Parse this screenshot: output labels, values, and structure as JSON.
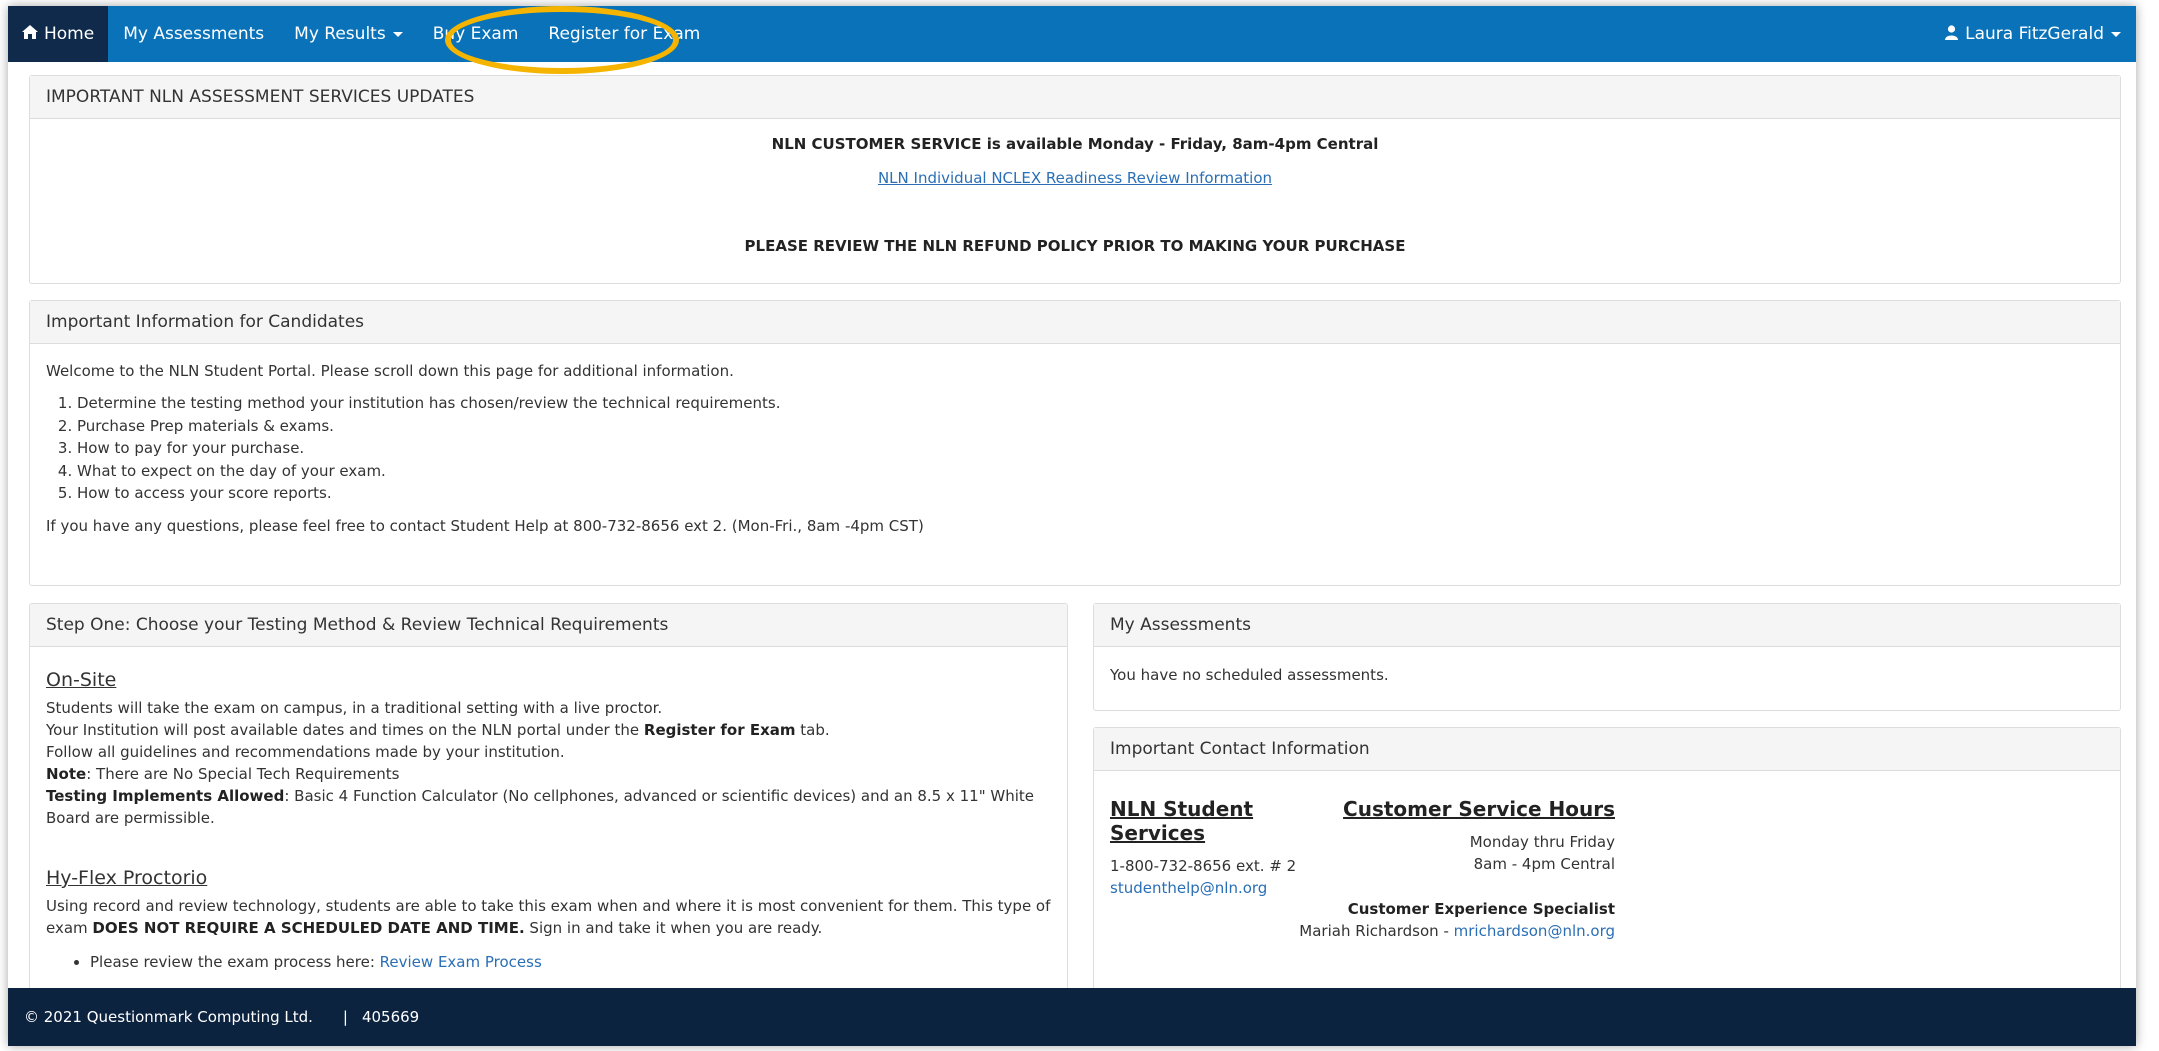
{
  "nav": {
    "home": "Home",
    "assessments": "My Assessments",
    "results": "My Results",
    "buy": "Buy Exam",
    "register": "Register for Exam",
    "user": "Laura FitzGerald"
  },
  "updates": {
    "heading": "IMPORTANT NLN ASSESSMENT SERVICES UPDATES",
    "customer_service": "NLN CUSTOMER SERVICE is available Monday - Friday, 8am-4pm Central",
    "nclex_link": "NLN Individual NCLEX Readiness Review Information",
    "refund": "PLEASE REVIEW THE NLN REFUND POLICY PRIOR TO MAKING YOUR PURCHASE"
  },
  "candidates": {
    "heading": "Important Information for Candidates",
    "welcome": "Welcome to the NLN Student Portal. Please scroll down this page for additional information.",
    "steps": [
      "Determine the testing method your institution has chosen/review the technical requirements.",
      "Purchase Prep materials & exams.",
      "How to pay for your purchase.",
      "What to expect on the day of your exam.",
      "How to access your score reports."
    ],
    "questions": "If you have any questions, please feel free to contact Student Help at 800-732-8656 ext 2. (Mon-Fri., 8am -4pm CST)"
  },
  "step_one": {
    "heading": "Step One: Choose your Testing Method & Review Technical Requirements",
    "onsite": {
      "title": "On-Site",
      "l1": "Students will take the exam on campus, in a traditional setting with a live proctor.",
      "l2_pre": "Your Institution will post available dates and times on the NLN portal under the ",
      "l2_bold": "Register for Exam",
      "l2_post": " tab.",
      "l3": "Follow all guidelines and recommendations made by your institution.",
      "note_label": "Note",
      "note_text": ": There are No Special Tech Requirements",
      "impl_label": "Testing Implements Allowed",
      "impl_text": ": Basic 4 Function Calculator (No cellphones, advanced or scientific devices) and an 8.5 x 11\" White Board are permissible."
    },
    "hyflex": {
      "title": "Hy-Flex Proctorio",
      "p_pre": "Using record and review technology, students are able to take this exam when and where it is most convenient for them. This type of exam ",
      "p_bold": "DOES NOT REQUIRE A SCHEDULED DATE AND TIME.",
      "p_post": " Sign in and take it when you are ready.",
      "bullet_pre": "Please review the exam process here: ",
      "bullet_link": "Review Exam Process"
    }
  },
  "my_assessments": {
    "heading": "My Assessments",
    "empty": "You have no scheduled assessments."
  },
  "contact": {
    "heading": "Important Contact Information",
    "services_title": "NLN Student Services",
    "phone": "1-800-732-8656 ext. # 2",
    "email": "studenthelp@nln.org",
    "hours_title": "Customer Service Hours",
    "days": "Monday thru Friday",
    "time": "8am - 4pm Central",
    "specialist_title": "Customer Experience Specialist",
    "specialist_name": "Mariah Richardson - ",
    "specialist_email": "mrichardson@nln.org"
  },
  "footer": {
    "copyright": "© 2021 Questionmark Computing Ltd.",
    "separator": "|",
    "build": "405669"
  },
  "colors": {
    "navbar": "#0a72b8",
    "nav_active": "#0f2a4a",
    "highlight": "#f4b400",
    "footer": "#0c2340"
  }
}
